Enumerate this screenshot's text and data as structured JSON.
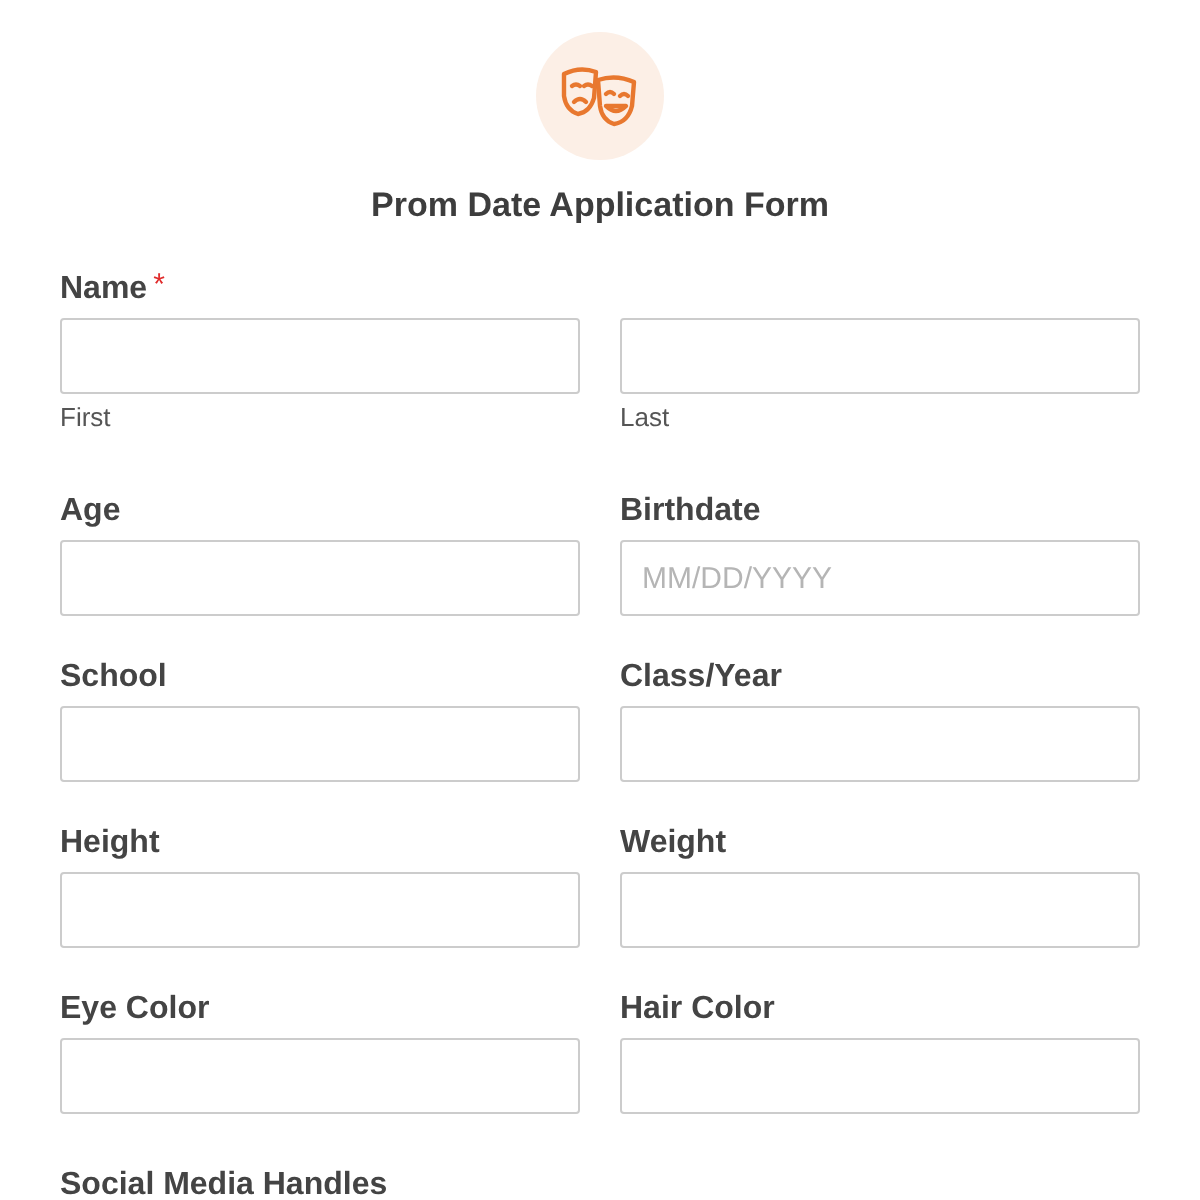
{
  "form": {
    "title": "Prom Date Application Form"
  },
  "name_field": {
    "label": "Name",
    "required": true,
    "required_mark": "*",
    "parts": [
      {
        "sublabel": "First"
      },
      {
        "sublabel": "Last"
      }
    ]
  },
  "fields": [
    {
      "label": "Age"
    },
    {
      "label": "Birthdate",
      "placeholder": "MM/DD/YYYY"
    },
    {
      "label": "School"
    },
    {
      "label": "Class/Year"
    },
    {
      "label": "Height"
    },
    {
      "label": "Weight"
    },
    {
      "label": "Eye Color"
    },
    {
      "label": "Hair Color"
    }
  ],
  "next_section": {
    "label": "Social Media Handles"
  }
}
